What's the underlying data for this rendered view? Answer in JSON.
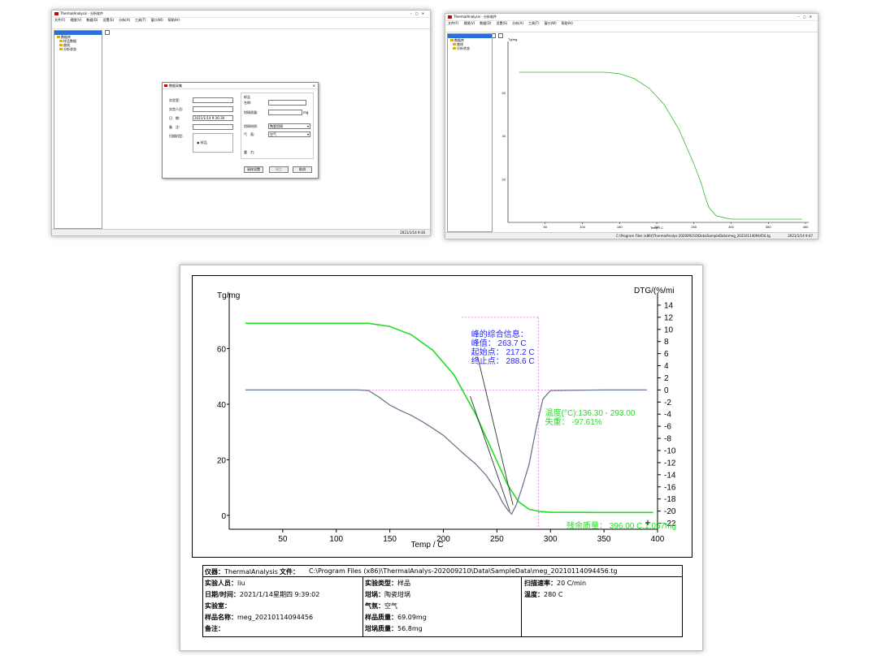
{
  "window1": {
    "title": "ThermalAnalysis - 分析软件",
    "menu": [
      "文件(F)",
      "视图(V)",
      "数据(D)",
      "设置(S)",
      "分析(A)",
      "工具(T)",
      "窗口(W)",
      "帮助(H)"
    ],
    "tree": [
      "数据库",
      "样品数据",
      "曲线",
      "分析状态"
    ],
    "status_right": "2021/1/14  9:36",
    "dialog": {
      "title": "数据采集",
      "left_labels": [
        "实验室:",
        "实验人员:",
        "日　期:",
        "备　注:",
        "扫描机型:"
      ],
      "date_value": "2021/1/14 9:36:30",
      "scan_option": "样品",
      "group_title": "样品",
      "right_labels": [
        "名称:",
        "坩埚质量:",
        "坩埚材质:",
        "气　氛:",
        "重　力:"
      ],
      "mass_unit": "mg",
      "crucible_value": "陶瓷坩埚",
      "atmosphere_value": "空气",
      "buttons": [
        "采样设置",
        "确定",
        "取消"
      ]
    }
  },
  "window2": {
    "title": "ThermalAnalysis - 分析软件",
    "menu": [
      "文件(F)",
      "视图(V)",
      "数据(D)",
      "设置(S)",
      "分析(A)",
      "工具(T)",
      "窗口(W)",
      "帮助(H)"
    ],
    "tree": [
      "数据库",
      "曲线",
      "分析状态"
    ],
    "status_path": "C:\\Program Files (x86)\\ThermalAnalys-202009210\\Data\\SampleData\\meg_20210114094456.tg",
    "status_right": "2021/1/14  9:47"
  },
  "chart_data": [
    {
      "type": "line",
      "ylabel": "Tg/mg",
      "xlabel": "Temp / C",
      "xlim": [
        0,
        400
      ],
      "ylim": [
        0,
        80
      ],
      "x_ticks": [
        50,
        100,
        150,
        200,
        250,
        300,
        350,
        400
      ],
      "y_ticks": [
        20,
        40,
        60
      ],
      "series": [
        {
          "color": "#33b833",
          "x": [
            15,
            50,
            100,
            130,
            150,
            170,
            190,
            210,
            230,
            250,
            260,
            265,
            270,
            280,
            300,
            350,
            395
          ],
          "y": [
            69.5,
            69.5,
            69.5,
            69.5,
            68.8,
            66.5,
            62,
            54.5,
            43,
            27,
            18,
            12,
            7,
            3,
            1.5,
            1.5,
            1.5
          ]
        }
      ]
    },
    {
      "type": "line",
      "ylabel": "Tg/mg",
      "y2label": "DTG/(%/mi",
      "xlabel": "Temp / C",
      "xlim": [
        0,
        400
      ],
      "ylim": [
        -5,
        80
      ],
      "y2lim": [
        -23,
        16
      ],
      "x_ticks": [
        50,
        100,
        150,
        200,
        250,
        300,
        350,
        400
      ],
      "y_ticks": [
        0,
        20,
        40,
        60
      ],
      "y2_ticks": [
        14,
        12,
        10,
        8,
        6,
        4,
        2,
        0,
        -2,
        -4,
        -6,
        -8,
        -10,
        -12,
        -14,
        -16,
        -18,
        -20,
        -22
      ],
      "series": [
        {
          "name": "TG",
          "axis": "left",
          "color": "#22dd22",
          "x": [
            15,
            50,
            100,
            130,
            150,
            170,
            190,
            210,
            230,
            250,
            260,
            270,
            280,
            290,
            300,
            350,
            396
          ],
          "y": [
            69.1,
            69.1,
            69.1,
            69.1,
            68,
            65,
            59.5,
            50.5,
            36.5,
            19.5,
            11,
            5,
            2.2,
            1.4,
            1.1,
            1.06,
            1.057
          ]
        },
        {
          "name": "DTG",
          "axis": "right",
          "color": "#6a7890",
          "x": [
            15,
            100,
            120,
            130,
            140,
            150,
            160,
            170,
            180,
            190,
            200,
            210,
            220,
            230,
            240,
            250,
            255,
            260,
            263.7,
            268,
            273,
            280,
            287,
            293,
            300,
            350,
            390
          ],
          "y": [
            0,
            0,
            0,
            -0.1,
            -1.2,
            -2.5,
            -3.4,
            -4.2,
            -5.2,
            -6.3,
            -7.5,
            -9.1,
            -10.7,
            -12.2,
            -14.1,
            -16.7,
            -18.5,
            -19.8,
            -20.5,
            -19.0,
            -16.4,
            -12.3,
            -6,
            -1.5,
            -0.1,
            0,
            0
          ]
        }
      ],
      "annotations": {
        "peak_info": [
          "峰的综合信息：",
          "峰值： 263.7 C",
          "起始点： 217.2 C",
          "终止点： 288.6 C"
        ],
        "range_info": [
          "温度(°C):136.30 - 293.00",
          "失重： -97.61%"
        ],
        "residual": "残余质量： 396.00 C,1.057mg"
      }
    }
  ],
  "report": {
    "instrument_label": "仪器：",
    "instrument_value": "ThermalAnalysis",
    "file_label": "文件：",
    "file_value": "C:\\Program Files (x86)\\ThermalAnalys-202009210\\Data\\SampleData\\meg_20210114094456.tg",
    "col1": [
      {
        "label": "实验人员：",
        "value": "liu"
      },
      {
        "label": "日期/时间：",
        "value": "2021/1/14星期四 9:39:02"
      },
      {
        "label": "实验室：",
        "value": ""
      },
      {
        "label": "样品名称：",
        "value": "meg_20210114094456"
      },
      {
        "label": "备注：",
        "value": ""
      }
    ],
    "col2": [
      {
        "label": "实验类型：",
        "value": "样品"
      },
      {
        "label": "坩埚：",
        "value": "陶瓷坩埚"
      },
      {
        "label": "气氛：",
        "value": "空气"
      },
      {
        "label": "样品质量：",
        "value": "69.09mg"
      },
      {
        "label": "坩埚质量：",
        "value": "56.8mg"
      }
    ],
    "col3": [
      {
        "label": "扫描速率：",
        "value": "20 C/min"
      },
      {
        "label": "温度：",
        "value": "280 C"
      }
    ]
  }
}
